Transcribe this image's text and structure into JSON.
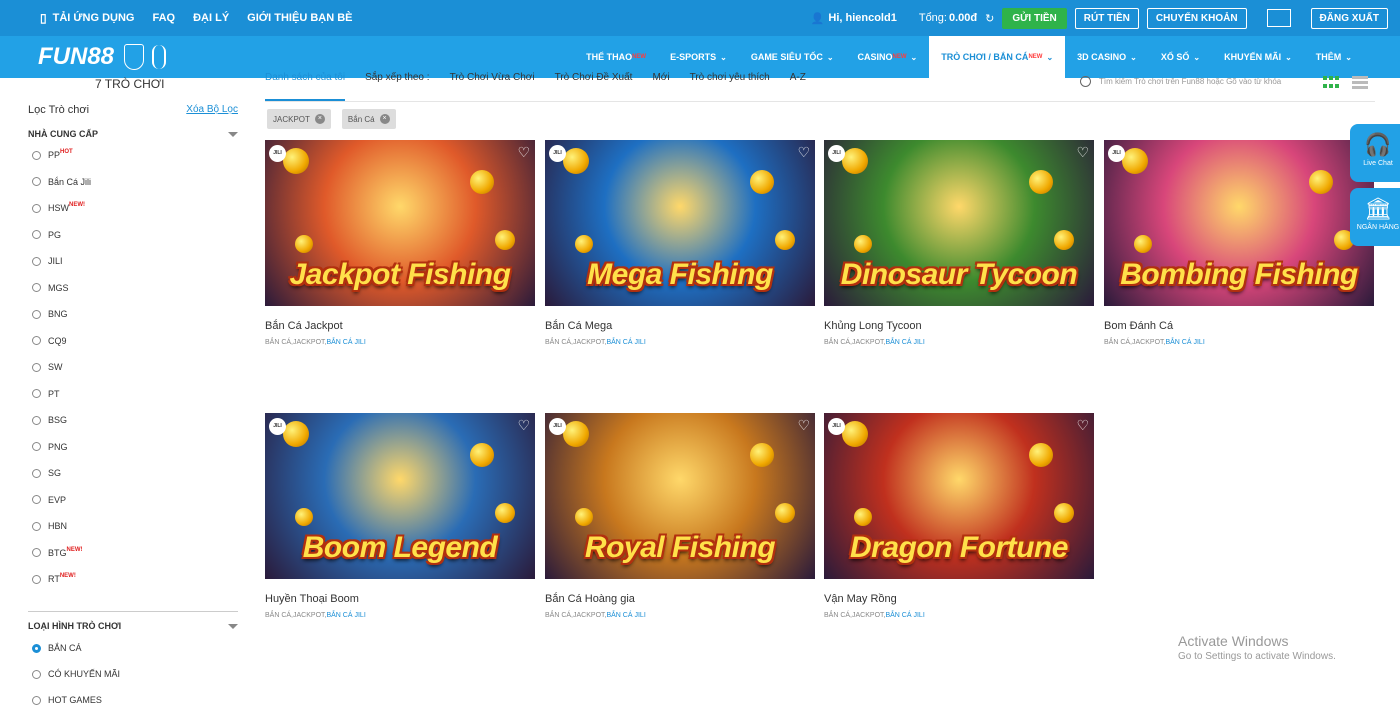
{
  "topbar": {
    "links": [
      "TẢI ỨNG DỤNG",
      "FAQ",
      "ĐẠI LÝ",
      "GIỚI THIỆU BẠN BÈ"
    ],
    "greeting": "Hi, hiencold1",
    "balance_label": "Tổng:",
    "balance_value": "0.00đ",
    "deposit": "GỬI TIỀN",
    "withdraw": "RÚT TIỀN",
    "transfer": "CHUYỂN KHOẢN",
    "logout": "ĐĂNG XUẤT"
  },
  "navbar": {
    "logo": "FUN88",
    "items": [
      {
        "label": "THỂ THAO",
        "tag": "NEW"
      },
      {
        "label": "E-SPORTS",
        "tag": ""
      },
      {
        "label": "GAME SIÊU TỐC",
        "tag": ""
      },
      {
        "label": "CASINO",
        "tag": "NEW"
      },
      {
        "label": "TRÒ CHƠI / BẮN CÁ",
        "tag": "NEW"
      },
      {
        "label": "3D CASINO",
        "tag": ""
      },
      {
        "label": "XỔ SỐ",
        "tag": ""
      },
      {
        "label": "KHUYẾN MÃI",
        "tag": ""
      },
      {
        "label": "THÊM",
        "tag": ""
      }
    ]
  },
  "count_label": "7 TRÒ CHƠI",
  "tabs": [
    "Danh sách của tôi",
    "Sắp xếp theo :",
    "Trò Chơi Vừa Chơi",
    "Trò Chơi Đề Xuất",
    "Mới",
    "Trò chơi yêu thích",
    "A-Z"
  ],
  "search": {
    "placeholder": "Tìm kiếm Trò chơi trên Fun88 hoặc Gõ vào từ khóa"
  },
  "chips": [
    "JACKPOT",
    "Bắn Cá"
  ],
  "filter": {
    "title": "Lọc Trò chơi",
    "clear": "Xóa Bộ Lọc",
    "providers_title": "NHÀ CUNG CẤP",
    "providers": [
      {
        "name": "PP",
        "tag": "HOT"
      },
      {
        "name": "Bắn Cá Jili",
        "tag": ""
      },
      {
        "name": "HSW",
        "tag": "NEW!"
      },
      {
        "name": "PG",
        "tag": ""
      },
      {
        "name": "JILI",
        "tag": ""
      },
      {
        "name": "MGS",
        "tag": ""
      },
      {
        "name": "BNG",
        "tag": ""
      },
      {
        "name": "CQ9",
        "tag": ""
      },
      {
        "name": "SW",
        "tag": ""
      },
      {
        "name": "PT",
        "tag": ""
      },
      {
        "name": "BSG",
        "tag": ""
      },
      {
        "name": "PNG",
        "tag": ""
      },
      {
        "name": "SG",
        "tag": ""
      },
      {
        "name": "EVP",
        "tag": ""
      },
      {
        "name": "HBN",
        "tag": ""
      },
      {
        "name": "BTG",
        "tag": "NEW!"
      },
      {
        "name": "RT",
        "tag": "NEW!"
      }
    ],
    "types_title": "LOẠI HÌNH TRÒ CHƠI",
    "types": [
      {
        "name": "BẮN CÁ",
        "checked": true
      },
      {
        "name": "CÓ KHUYẾN MÃI",
        "checked": false
      },
      {
        "name": "HOT GAMES",
        "checked": false
      }
    ]
  },
  "games": [
    {
      "name": "Bắn Cá Jackpot",
      "art_title": "Jackpot Fishing",
      "badge": "JILI",
      "cats": "BẮN CÁ,JACKPOT,",
      "cat_link": "BẮN CÁ JILI",
      "bg": "#e05a2a"
    },
    {
      "name": "Bắn Cá Mega",
      "art_title": "Mega Fishing",
      "badge": "JILI",
      "cats": "BẮN CÁ,JACKPOT,",
      "cat_link": "BẮN CÁ JILI",
      "bg": "#1e6fc2"
    },
    {
      "name": "Khủng Long Tycoon",
      "art_title": "Dinosaur Tycoon",
      "badge": "JILI",
      "cats": "BẮN CÁ,JACKPOT,",
      "cat_link": "BẮN CÁ JILI",
      "bg": "#3d8a2e"
    },
    {
      "name": "Bom Đánh Cá",
      "art_title": "Bombing Fishing",
      "badge": "JILI",
      "cats": "BẮN CÁ,JACKPOT,",
      "cat_link": "BẮN CÁ JILI",
      "bg": "#d8467a"
    },
    {
      "name": "Huyền Thoại Boom",
      "art_title": "Boom Legend",
      "badge": "JILI",
      "cats": "BẮN CÁ,JACKPOT,",
      "cat_link": "BẮN CÁ JILI",
      "bg": "#2a6cb5"
    },
    {
      "name": "Bắn Cá Hoàng gia",
      "art_title": "Royal Fishing",
      "badge": "JILI",
      "cats": "BẮN CÁ,JACKPOT,",
      "cat_link": "BẮN CÁ JILI",
      "bg": "#c8781e"
    },
    {
      "name": "Vận May Rồng",
      "art_title": "Dragon Fortune",
      "badge": "JILI",
      "cats": "BẮN CÁ,JACKPOT,",
      "cat_link": "BẮN CÁ JILI",
      "bg": "#c0301e"
    }
  ],
  "fab": {
    "chat": "Live Chat",
    "bank": "NGÂN HÀNG"
  },
  "watermark": {
    "line1": "Activate Windows",
    "line2": "Go to Settings to activate Windows."
  }
}
